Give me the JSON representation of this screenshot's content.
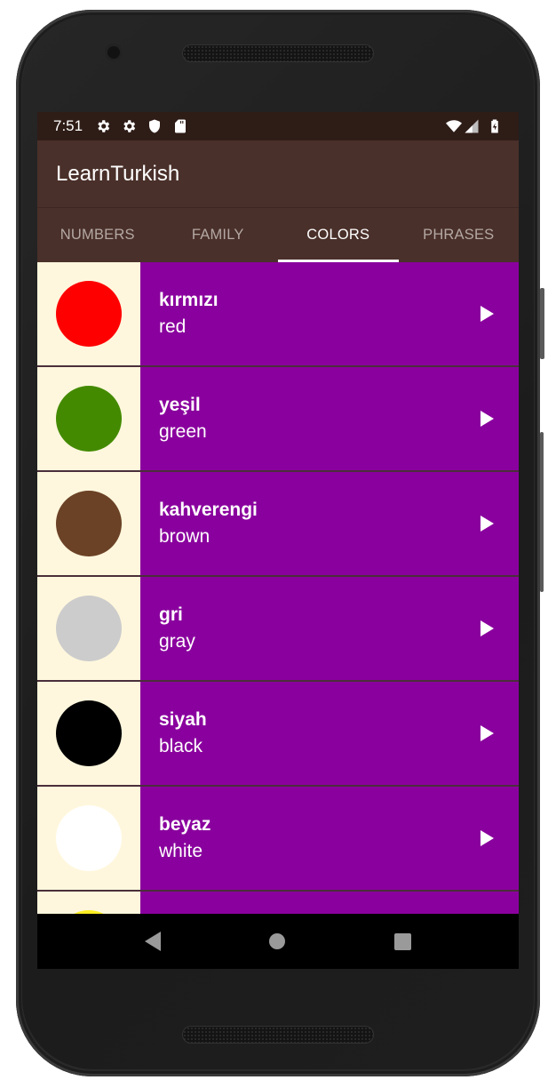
{
  "status_bar": {
    "time": "7:51",
    "left_icons": [
      "settings-icon",
      "settings-icon",
      "shield-icon",
      "sd-card-icon"
    ],
    "right_icons": [
      "wifi-icon",
      "cell-signal-icon",
      "battery-charging-icon"
    ]
  },
  "app_bar": {
    "title": "LearnTurkish"
  },
  "tabs": [
    {
      "label": "NUMBERS",
      "active": false
    },
    {
      "label": "FAMILY",
      "active": false
    },
    {
      "label": "COLORS",
      "active": true
    },
    {
      "label": "PHRASES",
      "active": false
    }
  ],
  "colors": {
    "status_bar_bg": "#2e1c17",
    "app_bar_bg": "#4a302a",
    "swatch_bg": "#fff7dd",
    "row_bg": "#8a009e",
    "divider": "#4a2f3a"
  },
  "words": [
    {
      "turkish": "kırmızı",
      "english": "red",
      "swatch": "#ff0000"
    },
    {
      "turkish": "yeşil",
      "english": "green",
      "swatch": "#438a00"
    },
    {
      "turkish": "kahverengi",
      "english": "brown",
      "swatch": "#6b4226"
    },
    {
      "turkish": "gri",
      "english": "gray",
      "swatch": "#cccccc"
    },
    {
      "turkish": "siyah",
      "english": "black",
      "swatch": "#000000"
    },
    {
      "turkish": "beyaz",
      "english": "white",
      "swatch": "#ffffff"
    },
    {
      "turkish": "",
      "english": "",
      "swatch": "#ffee22"
    }
  ],
  "nav_bar": {
    "buttons": [
      "back-icon",
      "home-icon",
      "recents-icon"
    ]
  }
}
